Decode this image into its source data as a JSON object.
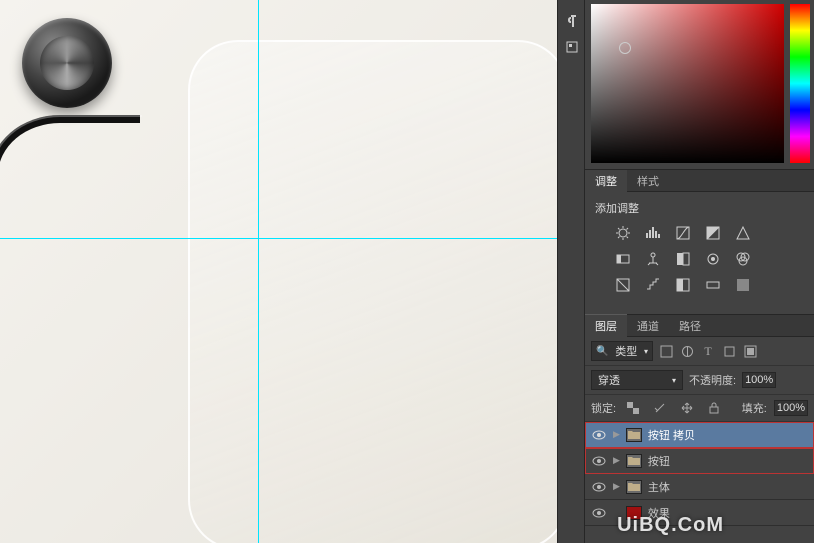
{
  "adjustments": {
    "tabs": [
      "调整",
      "样式"
    ],
    "label": "添加调整"
  },
  "layers_panel": {
    "tabs": [
      "图层",
      "通道",
      "路径"
    ],
    "filter_type": "类型",
    "blend_mode": "穿透",
    "opacity_label": "不透明度:",
    "opacity_value": "100%",
    "lock_label": "锁定:",
    "fill_label": "填充:",
    "fill_value": "100%",
    "layers": [
      {
        "name": "按钮 拷贝",
        "type": "folder",
        "selected": true,
        "highlighted": true
      },
      {
        "name": "按钮",
        "type": "folder",
        "selected": false,
        "highlighted": true
      },
      {
        "name": "主体",
        "type": "folder",
        "selected": false,
        "highlighted": false
      },
      {
        "name": "效果",
        "type": "layer-red",
        "selected": false,
        "highlighted": false
      }
    ]
  },
  "watermark": "UiBQ.CoM",
  "icons": {
    "eye": "eye-icon",
    "folder": "folder-icon",
    "search": "search-icon"
  }
}
